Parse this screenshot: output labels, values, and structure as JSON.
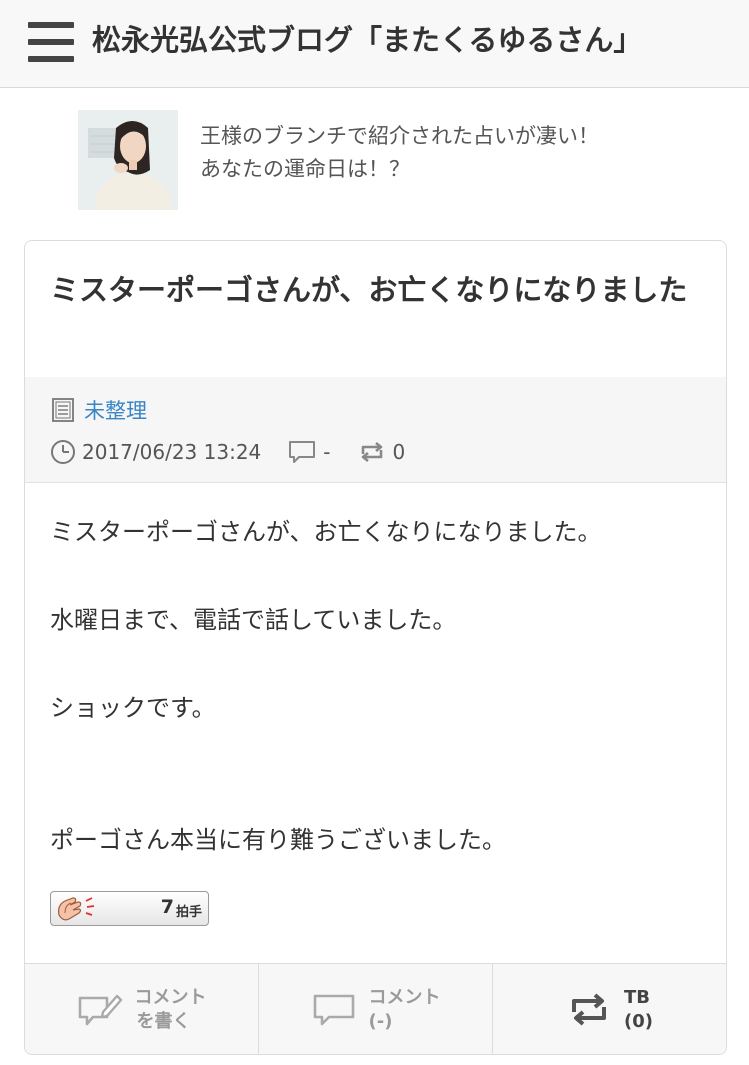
{
  "header": {
    "title": "松永光弘公式ブログ「またくるゆるさん」",
    "menu_icon": "hamburger-menu-icon"
  },
  "ad": {
    "line1": "王様のブランチで紹介された占いが凄い！",
    "line2": "あなたの運命日は！？"
  },
  "post": {
    "title": "ミスターポーゴさんが、お亡くなりになりました",
    "category": "未整理",
    "datetime": "2017/06/23 13:24",
    "comment_count": "-",
    "tb_count": "0",
    "body": [
      "ミスターポーゴさんが、お亡くなりになりました。",
      "水曜日まで、電話で話していました。",
      "ショックです。",
      "ポーゴさん本当に有り難うございました。"
    ],
    "clap": {
      "count": "7",
      "label": "拍手"
    }
  },
  "footer": {
    "write_comment": [
      "コメント",
      "を書く"
    ],
    "comments": [
      "コメント",
      "(-)"
    ],
    "trackback": [
      "TB",
      "(0)"
    ]
  },
  "colors": {
    "link": "#3a85c6",
    "header_bg": "#f8f8f8",
    "meta_bg": "#f6f6f6"
  }
}
